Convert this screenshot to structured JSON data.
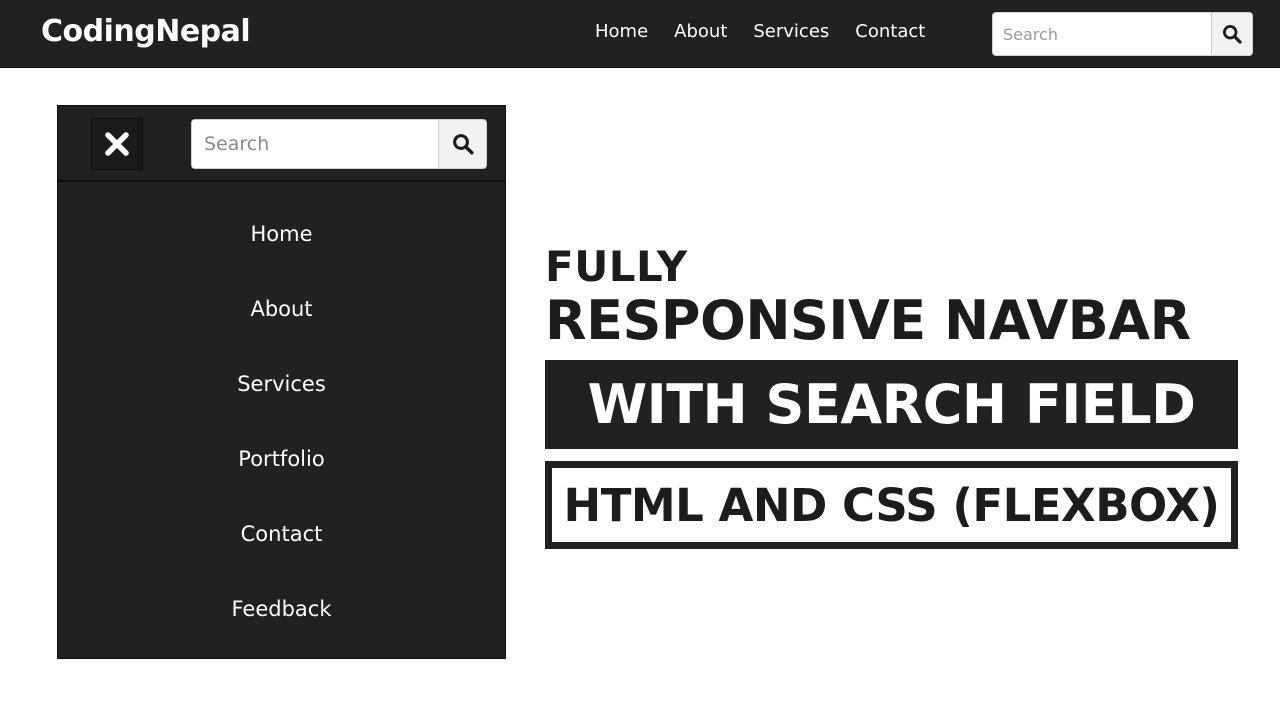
{
  "topbar": {
    "brand": "CodingNepal",
    "links": [
      "Home",
      "About",
      "Services",
      "Contact"
    ],
    "search": {
      "placeholder": "Search",
      "value": "",
      "button_icon": "search-icon"
    }
  },
  "mobile_menu": {
    "close_icon": "close-icon",
    "search": {
      "placeholder": "Search",
      "value": "",
      "button_icon": "search-icon"
    },
    "links": [
      "Home",
      "About",
      "Services",
      "Portfolio",
      "Contact",
      "Feedback"
    ]
  },
  "headline": {
    "line1": "FULLY",
    "line2": "RESPONSIVE NAVBAR",
    "line3": "WITH SEARCH FIELD",
    "line4": "HTML AND CSS (FLEXBOX)"
  },
  "colors": {
    "dark": "#212121",
    "white": "#ffffff",
    "text_dark": "#1c1c1c"
  }
}
